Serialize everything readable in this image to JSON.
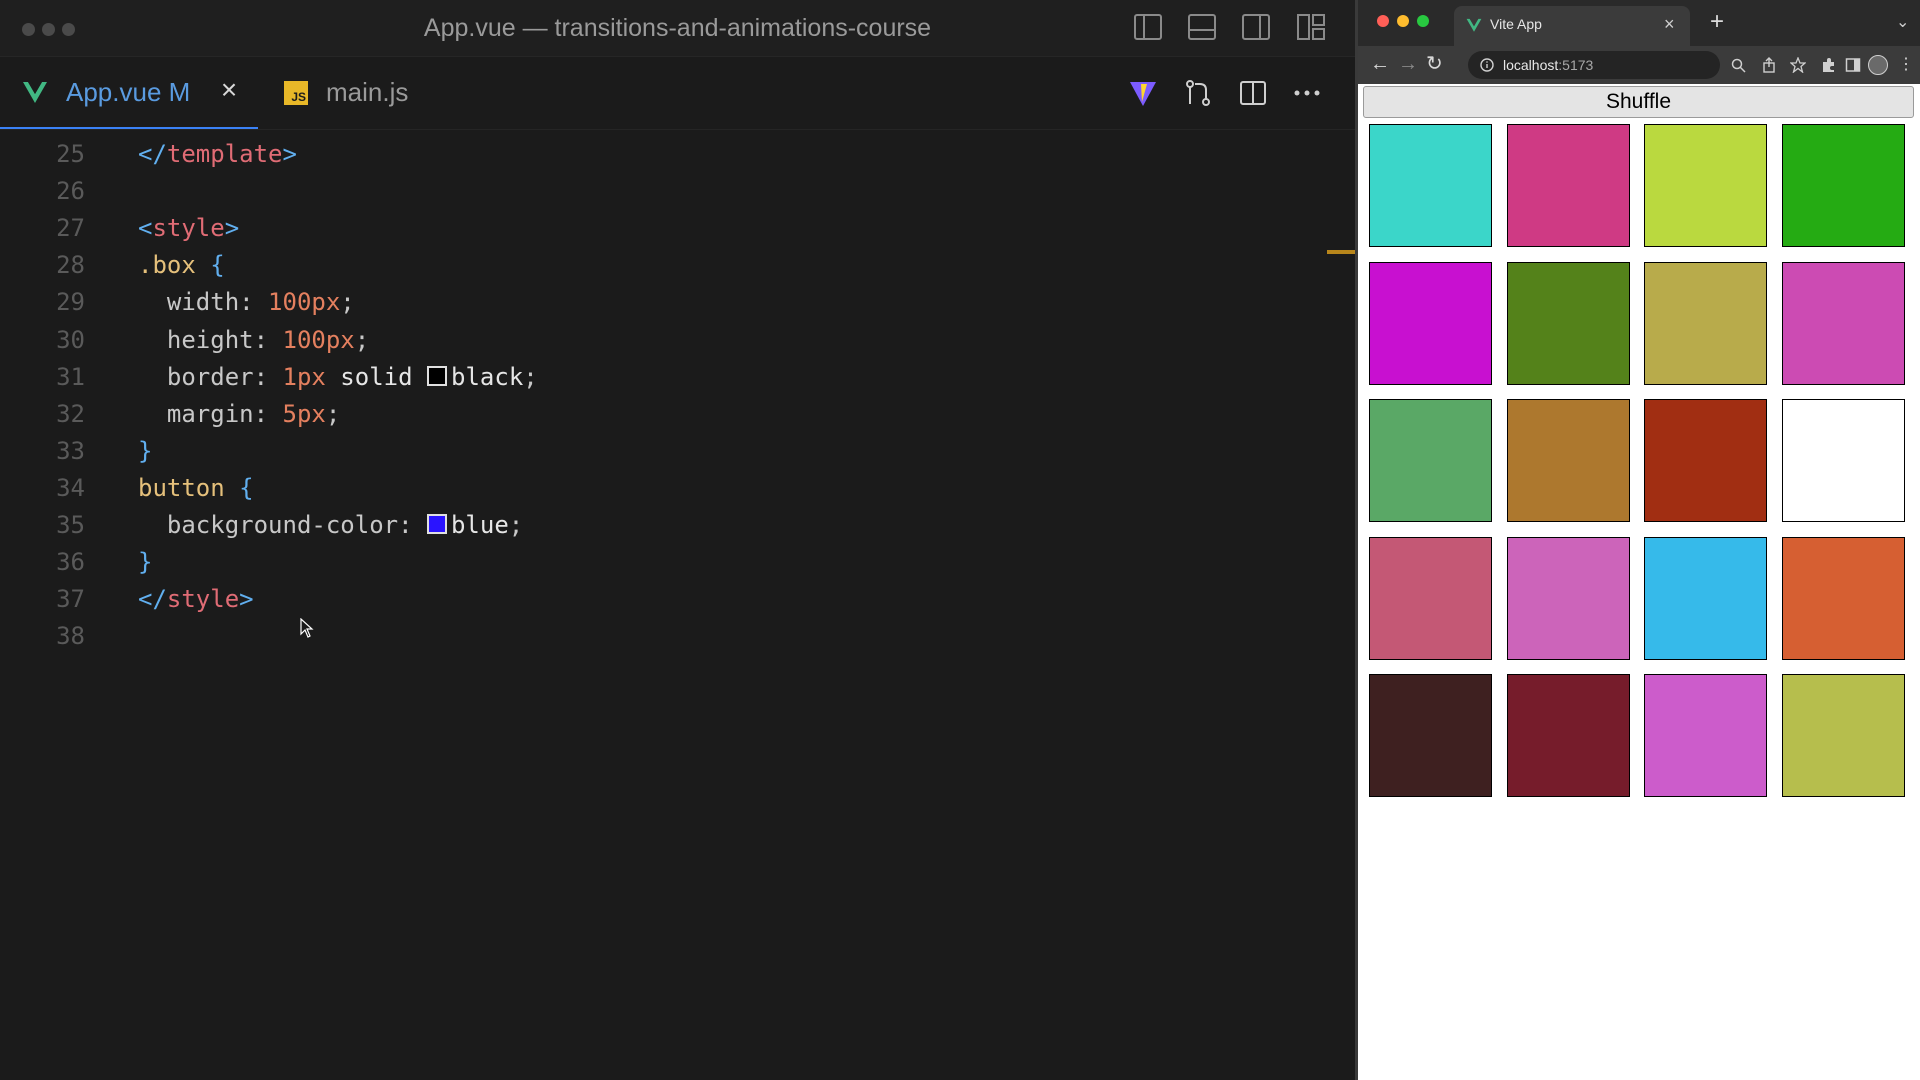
{
  "editor": {
    "window_title": "App.vue — transitions-and-animations-course",
    "tabs": [
      {
        "label": "App.vue",
        "status": "M",
        "close": "×"
      },
      {
        "label": "main.js",
        "badge": "JS"
      }
    ],
    "code_lines": [
      {
        "num": "25",
        "tokens": [
          [
            "c-brk",
            "</"
          ],
          [
            "c-tag",
            "template"
          ],
          [
            "c-brk",
            ">"
          ]
        ]
      },
      {
        "num": "26",
        "tokens": []
      },
      {
        "num": "27",
        "tokens": [
          [
            "c-brk",
            "<"
          ],
          [
            "c-tag",
            "style"
          ],
          [
            "c-brk",
            ">"
          ]
        ]
      },
      {
        "num": "28",
        "tokens": [
          [
            "c-sel",
            ".box"
          ],
          [
            "c-punc",
            " "
          ],
          [
            "c-brk",
            "{"
          ]
        ]
      },
      {
        "num": "29",
        "tokens": [
          [
            "c-prop",
            "  width: "
          ],
          [
            "c-num",
            "100px"
          ],
          [
            "c-punc",
            ";"
          ]
        ]
      },
      {
        "num": "30",
        "tokens": [
          [
            "c-prop",
            "  height: "
          ],
          [
            "c-num",
            "100px"
          ],
          [
            "c-punc",
            ";"
          ]
        ]
      },
      {
        "num": "31",
        "tokens": [
          [
            "c-prop",
            "  border: "
          ],
          [
            "c-num",
            "1px"
          ],
          [
            "c-val",
            " solid "
          ],
          [
            "swatch",
            "#000000"
          ],
          [
            "c-val",
            "black"
          ],
          [
            "c-punc",
            ";"
          ]
        ]
      },
      {
        "num": "32",
        "tokens": [
          [
            "c-prop",
            "  margin: "
          ],
          [
            "c-num",
            "5px"
          ],
          [
            "c-punc",
            ";"
          ]
        ]
      },
      {
        "num": "33",
        "tokens": [
          [
            "c-brk",
            "}"
          ]
        ]
      },
      {
        "num": "34",
        "tokens": [
          [
            "c-sel",
            "button"
          ],
          [
            "c-punc",
            " "
          ],
          [
            "c-brk",
            "{"
          ]
        ]
      },
      {
        "num": "35",
        "tokens": [
          [
            "c-prop",
            "  background-color: "
          ],
          [
            "swatch",
            "#2a14ff"
          ],
          [
            "c-val",
            "blue"
          ],
          [
            "c-punc",
            ";"
          ]
        ]
      },
      {
        "num": "36",
        "tokens": [
          [
            "c-brk",
            "}"
          ]
        ]
      },
      {
        "num": "37",
        "tokens": [
          [
            "c-brk",
            "</"
          ],
          [
            "c-tag",
            "style"
          ],
          [
            "c-brk",
            ">"
          ]
        ]
      },
      {
        "num": "38",
        "tokens": []
      }
    ]
  },
  "browser": {
    "tab_title": "Vite App",
    "tab_close": "×",
    "new_tab": "+",
    "url_host": "localhost",
    "url_port": ":5173",
    "page": {
      "button_label": "Shuffle",
      "boxes": [
        "#3bd6c9",
        "#cf3a84",
        "#bad93f",
        "#25ab13",
        "#c810d0",
        "#54821a",
        "#b8ab4b",
        "#cc4bb3",
        "#5aa866",
        "#ad782e",
        "#a12e12",
        "#ffffff",
        "#c45875",
        "#cc64ba",
        "#36baea",
        "#d65f32",
        "#3e2020",
        "#761c2b",
        "#cc5ccb",
        "#b6be4d"
      ]
    }
  },
  "colors": {
    "accent": "#3b82f6",
    "traffic_close": "#ff5f57",
    "traffic_min": "#febc2e",
    "traffic_max": "#28c840"
  }
}
